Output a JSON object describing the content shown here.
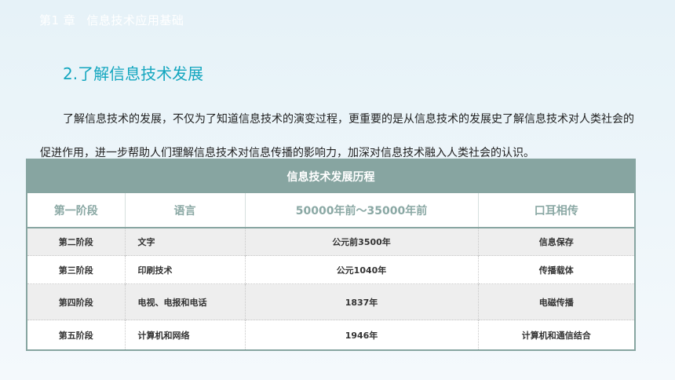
{
  "header": {
    "chapter_no": "第1 章",
    "chapter_title": "信息技术应用基础"
  },
  "section": {
    "title": "2.了解信息技术发展"
  },
  "body": {
    "paragraph": "了解信息技术的发展，不仅为了知道信息技术的演变过程，更重要的是从信息技术的发展史了解信息技术对人类社会的促进作用，进一步帮助人们理解信息技术对信息传播的影响力，加深对信息技术融入人类社会的认识。"
  },
  "table": {
    "caption": "信息技术发展历程",
    "header_row": [
      "第一阶段",
      "语言",
      "50000年前～35000年前",
      "口耳相传"
    ],
    "rows": [
      [
        "第二阶段",
        "文字",
        "公元前3500年",
        "信息保存"
      ],
      [
        "第三阶段",
        "印刷技术",
        "公元1040年",
        "传播载体"
      ],
      [
        "第四阶段",
        "电视、电报和电话",
        "1837年",
        "电磁传播"
      ],
      [
        "第五阶段",
        "计算机和网络",
        "1946年",
        "计算机和通信结合"
      ]
    ]
  }
}
